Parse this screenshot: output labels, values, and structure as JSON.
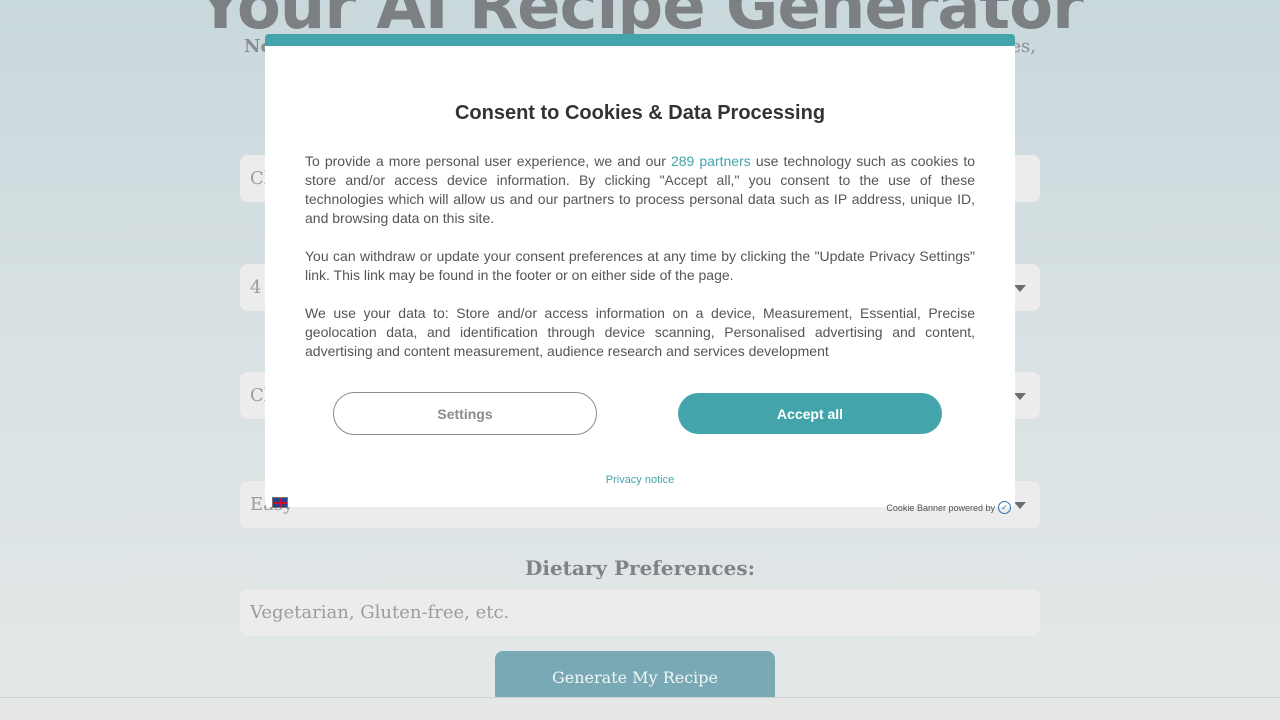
{
  "page": {
    "hero_title": "Your AI Recipe Generator",
    "intro_start": "No",
    "intro_end": "es,",
    "fields": {
      "ingredients_placeholder": "Cl",
      "servings_value": "4",
      "cuisine_value": "Cl",
      "difficulty_value": "Easy"
    },
    "dietary_label": "Dietary Preferences:",
    "dietary_placeholder": "Vegetarian, Gluten-free, etc.",
    "generate_button": "Generate My Recipe"
  },
  "modal": {
    "title": "Consent to Cookies & Data Processing",
    "p1_before_link": "To provide a more personal user experience, we and our ",
    "p1_link": "289 partners",
    "p1_after_link": " use technology such as cookies to store and/or access device information. By clicking \"Accept all,\" you consent to the use of these technologies which will allow us and our partners to process personal data such as IP address, unique ID, and browsing data on this site.",
    "p2": "You can withdraw or update your consent preferences at any time by clicking the \"Update Privacy Settings\" link. This link may be found in the footer or on either side of the page.",
    "p3": "We use your data to: Store and/or access information on a device, Measurement, Essential, Precise geolocation data, and identification through device scanning, Personalised advertising and content, advertising and content measurement, audience research and services development",
    "settings_button": "Settings",
    "accept_button": "Accept all",
    "privacy_link": "Privacy notice",
    "powered_by": "Cookie Banner powered by"
  }
}
